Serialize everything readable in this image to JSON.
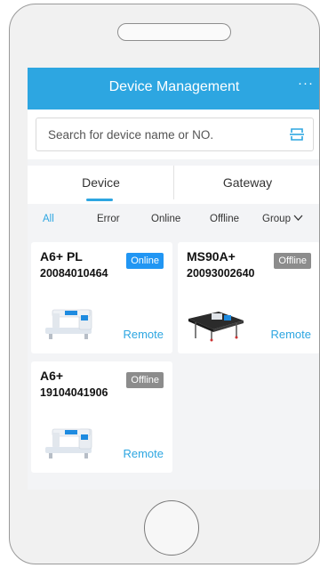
{
  "header": {
    "title": "Device Management",
    "more_label": "···"
  },
  "search": {
    "placeholder": "Search for device name or NO."
  },
  "tabs": [
    {
      "label": "Device",
      "active": true
    },
    {
      "label": "Gateway",
      "active": false
    }
  ],
  "filters": [
    {
      "label": "All",
      "active": true
    },
    {
      "label": "Error",
      "active": false
    },
    {
      "label": "Online",
      "active": false
    },
    {
      "label": "Offline",
      "active": false
    },
    {
      "label": "Group",
      "active": false
    }
  ],
  "devices": [
    {
      "model": "A6+ PL",
      "serial": "20084010464",
      "status": "Online",
      "action": "Remote",
      "icon": "sewing-machine-icon"
    },
    {
      "model": "MS90A+",
      "serial": "20093002640",
      "status": "Offline",
      "action": "Remote",
      "icon": "machine-table-icon"
    },
    {
      "model": "A6+",
      "serial": "19104041906",
      "status": "Offline",
      "action": "Remote",
      "icon": "sewing-machine-icon"
    }
  ],
  "colors": {
    "accent": "#2da6e1",
    "online": "#2196f3",
    "offline": "#8c8c8c"
  }
}
